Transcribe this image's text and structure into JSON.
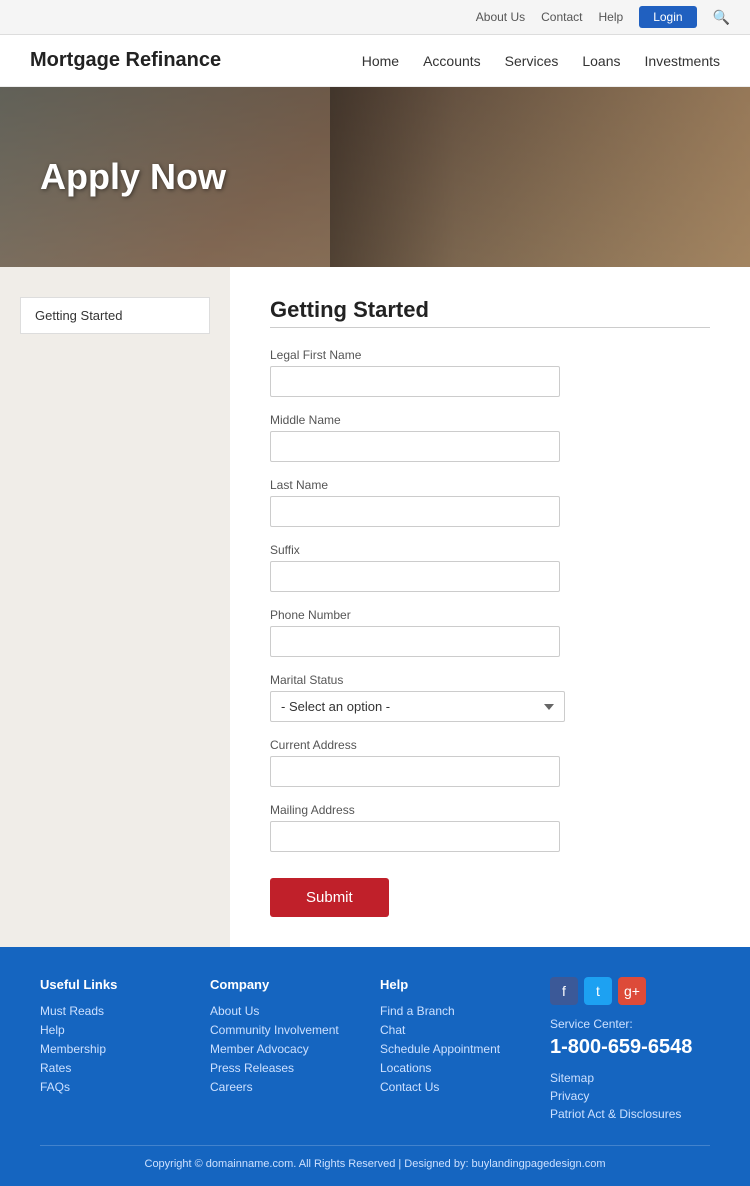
{
  "topbar": {
    "about_us": "About Us",
    "contact": "Contact",
    "help": "Help",
    "login": "Login",
    "search_icon": "🔍"
  },
  "header": {
    "site_title": "Mortgage Refinance",
    "nav": [
      {
        "label": "Home"
      },
      {
        "label": "Accounts"
      },
      {
        "label": "Services"
      },
      {
        "label": "Loans"
      },
      {
        "label": "Investments"
      }
    ]
  },
  "hero": {
    "headline": "Apply Now"
  },
  "sidebar": {
    "item_label": "Getting Started"
  },
  "form": {
    "title": "Getting Started",
    "fields": [
      {
        "label": "Legal First Name",
        "type": "text",
        "name": "legal_first_name"
      },
      {
        "label": "Middle Name",
        "type": "text",
        "name": "middle_name"
      },
      {
        "label": "Last Name",
        "type": "text",
        "name": "last_name"
      },
      {
        "label": "Suffix",
        "type": "text",
        "name": "suffix"
      },
      {
        "label": "Phone Number",
        "type": "text",
        "name": "phone_number"
      }
    ],
    "marital_status_label": "Marital Status",
    "marital_status_placeholder": "- Select an option -",
    "current_address_label": "Current Address",
    "mailing_address_label": "Mailing Address",
    "submit_label": "Submit"
  },
  "footer": {
    "useful_links": {
      "heading": "Useful Links",
      "items": [
        "Must Reads",
        "Help",
        "Membership",
        "Rates",
        "FAQs"
      ]
    },
    "company": {
      "heading": "Company",
      "items": [
        "About Us",
        "Community Involvement",
        "Member Advocacy",
        "Press Releases",
        "Careers"
      ]
    },
    "help": {
      "heading": "Help",
      "items": [
        "Find a Branch",
        "Chat",
        "Schedule Appointment",
        "Locations",
        "Contact Us"
      ]
    },
    "social": {
      "fb": "f",
      "tw": "t",
      "gp": "g+"
    },
    "service_center_label": "Service Center:",
    "phone": "1-800-659-6548",
    "bottom_links": [
      "Sitemap",
      "Privacy",
      "Patriot Act & Disclosures"
    ],
    "copyright": "Copyright © domainname.com. All Rights Reserved  |  Designed by: buylandingpagedesign.com"
  }
}
